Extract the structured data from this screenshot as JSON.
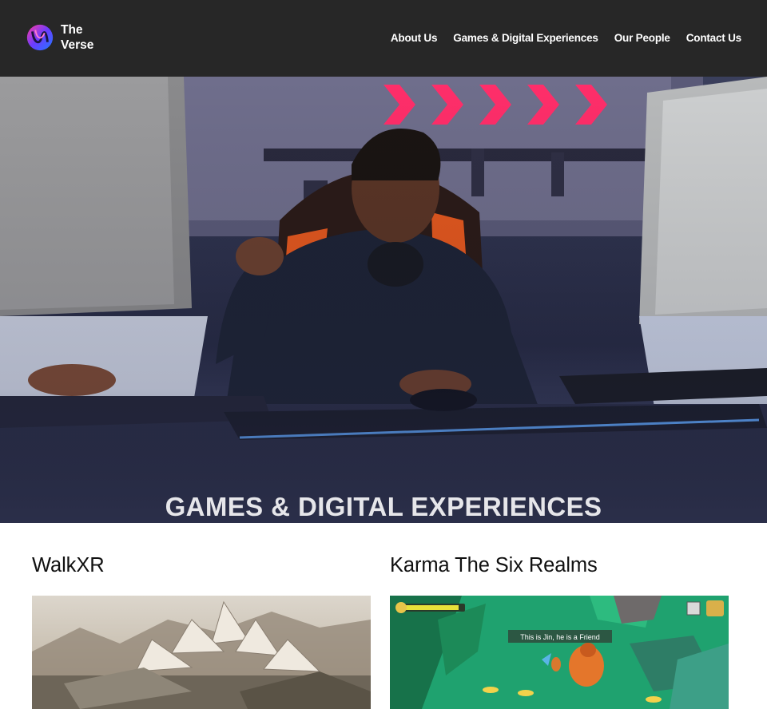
{
  "header": {
    "logo_text_line1": "The",
    "logo_text_line2": "Verse",
    "nav": [
      {
        "label": "About Us"
      },
      {
        "label": "Games & Digital Experiences"
      },
      {
        "label": "Our People"
      },
      {
        "label": "Contact Us"
      }
    ]
  },
  "hero": {
    "title": "GAMES & DIGITAL EXPERIENCES"
  },
  "projects": [
    {
      "title": "WalkXR"
    },
    {
      "title": "Karma The Six Realms",
      "screenshot_caption": "This is Jin, he is a Friend"
    }
  ],
  "colors": {
    "header_bg": "#272727",
    "hero_overlay": "#2b2f4a",
    "page_bg": "#ffffff",
    "game_green": "#1fa26f"
  }
}
